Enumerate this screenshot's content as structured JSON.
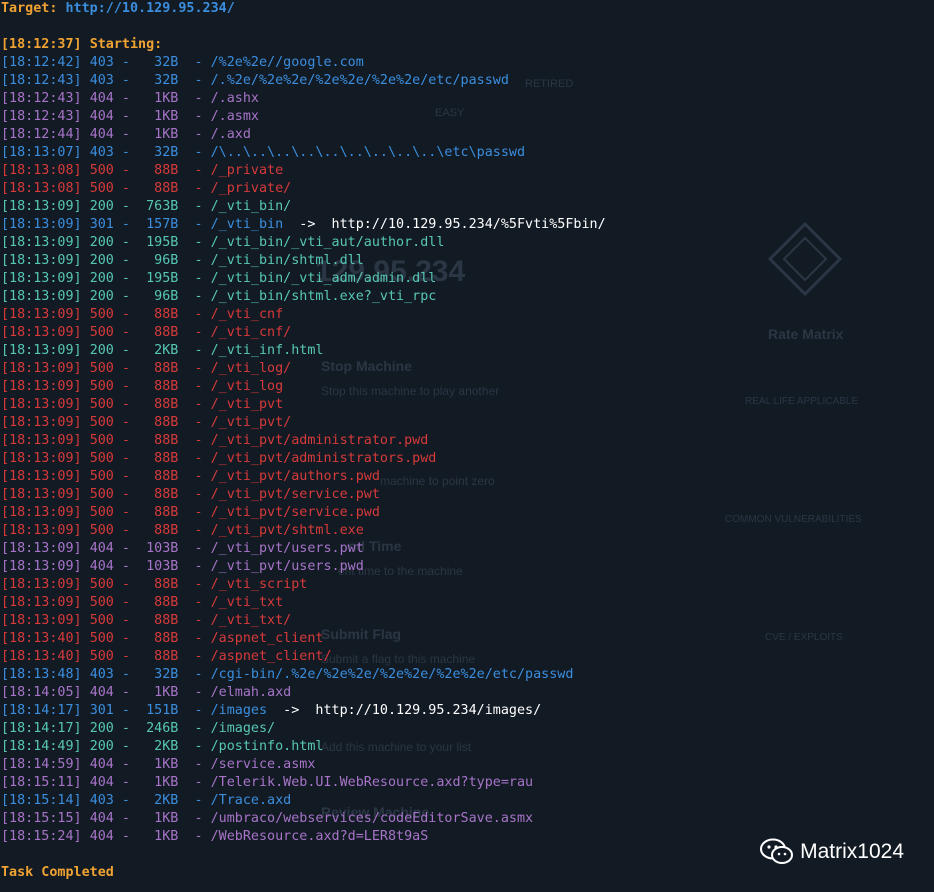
{
  "header": {
    "target_label": "Target: ",
    "target_url": "http://10.129.95.234/"
  },
  "start": {
    "time": "[18:12:37]",
    "text": "Starting:"
  },
  "lines": [
    {
      "t": "[18:12:42]",
      "s": "403",
      "sz": "32B",
      "p": "/%2e%2e//google.com",
      "c": "c403"
    },
    {
      "t": "[18:12:43]",
      "s": "403",
      "sz": "32B",
      "p": "/.%2e/%2e%2e/%2e%2e/%2e%2e/etc/passwd",
      "c": "c403"
    },
    {
      "t": "[18:12:43]",
      "s": "404",
      "sz": "1KB",
      "p": "/.ashx",
      "c": "c404"
    },
    {
      "t": "[18:12:43]",
      "s": "404",
      "sz": "1KB",
      "p": "/.asmx",
      "c": "c404"
    },
    {
      "t": "[18:12:44]",
      "s": "404",
      "sz": "1KB",
      "p": "/.axd",
      "c": "c404"
    },
    {
      "t": "[18:13:07]",
      "s": "403",
      "sz": "32B",
      "p": "/\\..\\..\\..\\..\\..\\..\\..\\..\\..\\etc\\passwd",
      "c": "c403"
    },
    {
      "t": "[18:13:08]",
      "s": "500",
      "sz": "88B",
      "p": "/_private",
      "c": "c500"
    },
    {
      "t": "[18:13:08]",
      "s": "500",
      "sz": "88B",
      "p": "/_private/",
      "c": "c500"
    },
    {
      "t": "[18:13:09]",
      "s": "200",
      "sz": "763B",
      "p": "/_vti_bin/",
      "c": "c200"
    },
    {
      "t": "[18:13:09]",
      "s": "301",
      "sz": "157B",
      "p": "/_vti_bin",
      "c": "c301",
      "r": "http://10.129.95.234/%5Fvti%5Fbin/"
    },
    {
      "t": "[18:13:09]",
      "s": "200",
      "sz": "195B",
      "p": "/_vti_bin/_vti_aut/author.dll",
      "c": "c200"
    },
    {
      "t": "[18:13:09]",
      "s": "200",
      "sz": "96B",
      "p": "/_vti_bin/shtml.dll",
      "c": "c200"
    },
    {
      "t": "[18:13:09]",
      "s": "200",
      "sz": "195B",
      "p": "/_vti_bin/_vti_adm/admin.dll",
      "c": "c200"
    },
    {
      "t": "[18:13:09]",
      "s": "200",
      "sz": "96B",
      "p": "/_vti_bin/shtml.exe?_vti_rpc",
      "c": "c200"
    },
    {
      "t": "[18:13:09]",
      "s": "500",
      "sz": "88B",
      "p": "/_vti_cnf",
      "c": "c500"
    },
    {
      "t": "[18:13:09]",
      "s": "500",
      "sz": "88B",
      "p": "/_vti_cnf/",
      "c": "c500"
    },
    {
      "t": "[18:13:09]",
      "s": "200",
      "sz": "2KB",
      "p": "/_vti_inf.html",
      "c": "c200"
    },
    {
      "t": "[18:13:09]",
      "s": "500",
      "sz": "88B",
      "p": "/_vti_log/",
      "c": "c500"
    },
    {
      "t": "[18:13:09]",
      "s": "500",
      "sz": "88B",
      "p": "/_vti_log",
      "c": "c500"
    },
    {
      "t": "[18:13:09]",
      "s": "500",
      "sz": "88B",
      "p": "/_vti_pvt",
      "c": "c500"
    },
    {
      "t": "[18:13:09]",
      "s": "500",
      "sz": "88B",
      "p": "/_vti_pvt/",
      "c": "c500"
    },
    {
      "t": "[18:13:09]",
      "s": "500",
      "sz": "88B",
      "p": "/_vti_pvt/administrator.pwd",
      "c": "c500"
    },
    {
      "t": "[18:13:09]",
      "s": "500",
      "sz": "88B",
      "p": "/_vti_pvt/administrators.pwd",
      "c": "c500"
    },
    {
      "t": "[18:13:09]",
      "s": "500",
      "sz": "88B",
      "p": "/_vti_pvt/authors.pwd",
      "c": "c500"
    },
    {
      "t": "[18:13:09]",
      "s": "500",
      "sz": "88B",
      "p": "/_vti_pvt/service.pwt",
      "c": "c500"
    },
    {
      "t": "[18:13:09]",
      "s": "500",
      "sz": "88B",
      "p": "/_vti_pvt/service.pwd",
      "c": "c500"
    },
    {
      "t": "[18:13:09]",
      "s": "500",
      "sz": "88B",
      "p": "/_vti_pvt/shtml.exe",
      "c": "c500"
    },
    {
      "t": "[18:13:09]",
      "s": "404",
      "sz": "103B",
      "p": "/_vti_pvt/users.pwt",
      "c": "c404"
    },
    {
      "t": "[18:13:09]",
      "s": "404",
      "sz": "103B",
      "p": "/_vti_pvt/users.pwd",
      "c": "c404"
    },
    {
      "t": "[18:13:09]",
      "s": "500",
      "sz": "88B",
      "p": "/_vti_script",
      "c": "c500"
    },
    {
      "t": "[18:13:09]",
      "s": "500",
      "sz": "88B",
      "p": "/_vti_txt",
      "c": "c500"
    },
    {
      "t": "[18:13:09]",
      "s": "500",
      "sz": "88B",
      "p": "/_vti_txt/",
      "c": "c500"
    },
    {
      "t": "[18:13:40]",
      "s": "500",
      "sz": "88B",
      "p": "/aspnet_client",
      "c": "c500"
    },
    {
      "t": "[18:13:40]",
      "s": "500",
      "sz": "88B",
      "p": "/aspnet_client/",
      "c": "c500"
    },
    {
      "t": "[18:13:48]",
      "s": "403",
      "sz": "32B",
      "p": "/cgi-bin/.%2e/%2e%2e/%2e%2e/%2e%2e/etc/passwd",
      "c": "c403"
    },
    {
      "t": "[18:14:05]",
      "s": "404",
      "sz": "1KB",
      "p": "/elmah.axd",
      "c": "c404"
    },
    {
      "t": "[18:14:17]",
      "s": "301",
      "sz": "151B",
      "p": "/images",
      "c": "c301",
      "r": "http://10.129.95.234/images/"
    },
    {
      "t": "[18:14:17]",
      "s": "200",
      "sz": "246B",
      "p": "/images/",
      "c": "c200"
    },
    {
      "t": "[18:14:49]",
      "s": "200",
      "sz": "2KB",
      "p": "/postinfo.html",
      "c": "c200"
    },
    {
      "t": "[18:14:59]",
      "s": "404",
      "sz": "1KB",
      "p": "/service.asmx",
      "c": "c404"
    },
    {
      "t": "[18:15:11]",
      "s": "404",
      "sz": "1KB",
      "p": "/Telerik.Web.UI.WebResource.axd?type=rau",
      "c": "c404"
    },
    {
      "t": "[18:15:14]",
      "s": "403",
      "sz": "2KB",
      "p": "/Trace.axd",
      "c": "c403"
    },
    {
      "t": "[18:15:15]",
      "s": "404",
      "sz": "1KB",
      "p": "/umbraco/webservices/codeEditorSave.asmx",
      "c": "c404"
    },
    {
      "t": "[18:15:24]",
      "s": "404",
      "sz": "1KB",
      "p": "/WebResource.axd?d=LER8t9aS",
      "c": "c404"
    }
  ],
  "footer": {
    "text": "Task Completed"
  },
  "watermark": {
    "text": "Matrix1024"
  },
  "background_ghost": {
    "retired": "RETIRED",
    "easy": "EASY",
    "ip": "129.95.234",
    "rate_matrix": "Rate Matrix",
    "stop_title": "Stop Machine",
    "stop_desc": "Stop this machine to play another",
    "reset_desc": "machine to point zero",
    "spend_title": "nd Time",
    "spend_desc": "ent time to the machine",
    "submit_title": "Submit Flag",
    "submit_desc": "Submit a flag to this machine",
    "add_desc": "Add this machine to your list",
    "review_title": "Review Machine",
    "real_life": "REAL LIFE APPLICABLE",
    "common": "COMMON VULNERABILITIES",
    "cve": "CVE / EXPLOITS"
  },
  "colors": {
    "background": "#121a24",
    "orange": "#f0a332",
    "s200": "#57c7b4",
    "s301": "#3b8ede",
    "s403": "#3b8ede",
    "s404": "#a774c8",
    "s500": "#d63a3a"
  }
}
